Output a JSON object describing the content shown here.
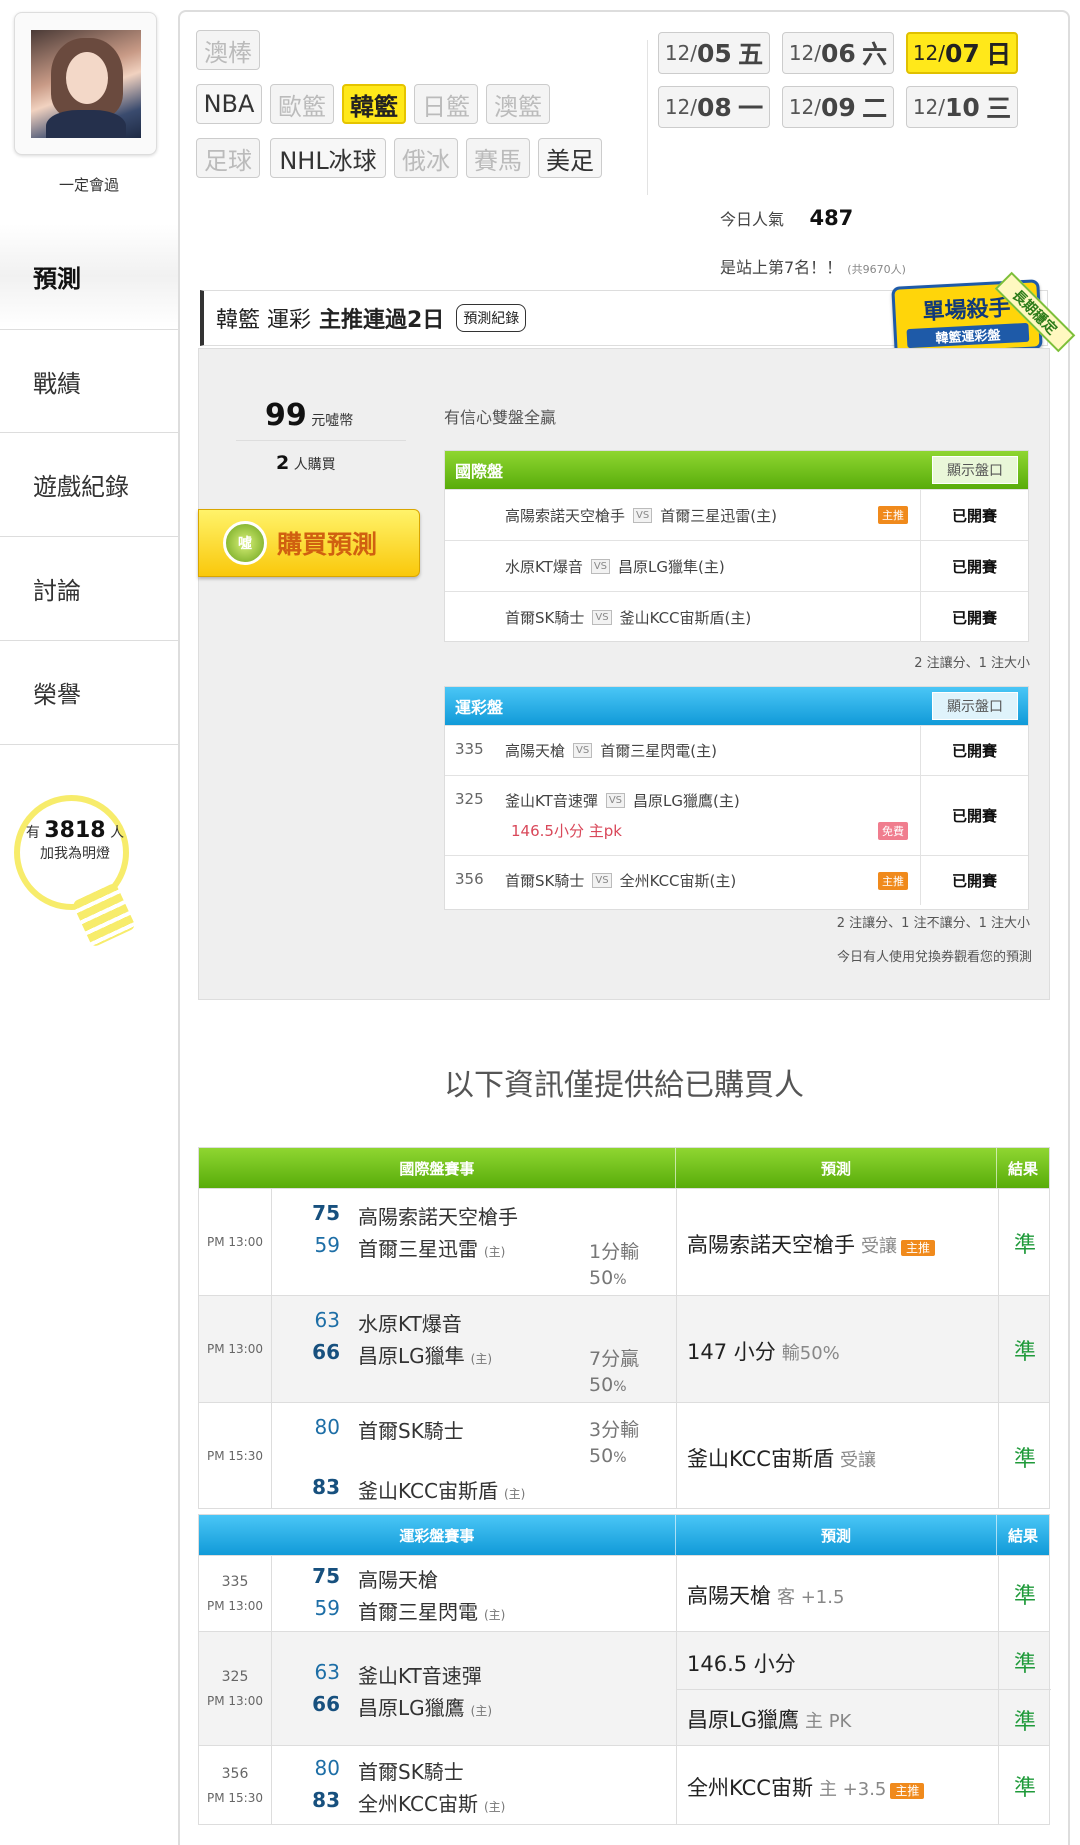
{
  "user": {
    "name": "一定會過"
  },
  "nav": [
    {
      "label": "預測",
      "active": true
    },
    {
      "label": "戰績"
    },
    {
      "label": "遊戲紀錄"
    },
    {
      "label": "討論"
    },
    {
      "label": "榮譽"
    }
  ],
  "lamp": {
    "prefix": "有",
    "count": "3818",
    "suffix": "人",
    "cta": "加我為明燈"
  },
  "sports": {
    "row1": [
      "澳棒"
    ],
    "row2": [
      "NBA",
      "歐籃",
      "韓籃",
      "日籃",
      "澳籃"
    ],
    "row3": [
      "足球",
      "NHL冰球",
      "俄冰",
      "賽馬",
      "美足"
    ],
    "selected": "韓籃"
  },
  "dates": [
    {
      "md": "12/",
      "d": "05",
      "w": "五"
    },
    {
      "md": "12/",
      "d": "06",
      "w": "六"
    },
    {
      "md": "12/",
      "d": "07",
      "w": "日",
      "selected": true
    },
    {
      "md": "12/",
      "d": "08",
      "w": "一"
    },
    {
      "md": "12/",
      "d": "09",
      "w": "二"
    },
    {
      "md": "12/",
      "d": "10",
      "w": "三"
    }
  ],
  "popularity": {
    "label": "今日人氣",
    "value": "487",
    "rank_text": "是站上第7名！！",
    "total": "(共9670人)"
  },
  "banner": {
    "title": "韓籃 運彩",
    "streak": "主推連過2日",
    "record_btn": "預測紀錄"
  },
  "badge": {
    "title": "單場殺手",
    "sub": "韓籃運彩盤",
    "ribbon": "長期穩定"
  },
  "offer": {
    "price": "99",
    "price_unit": "元噓幣",
    "buyers": "2",
    "buyers_unit": "人購買",
    "buy_label": "購買預測",
    "buy_icon": "噓",
    "confidence": "有信心雙盤全贏"
  },
  "intl": {
    "title": "國際盤",
    "show_btn": "顯示盤口",
    "rows": [
      {
        "home": "高陽索諾天空槍手",
        "vs": "VS",
        "away": "首爾三星迅雷(主)",
        "tag": "主推",
        "state": "已開賽"
      },
      {
        "home": "水原KT爆音",
        "vs": "VS",
        "away": "昌原LG獵隼(主)",
        "state": "已開賽"
      },
      {
        "home": "首爾SK騎士",
        "vs": "VS",
        "away": "釜山KCC宙斯盾(主)",
        "state": "已開賽"
      }
    ],
    "note": "2 注讓分、1 注大小"
  },
  "lottery": {
    "title": "運彩盤",
    "show_btn": "顯示盤口",
    "rows": [
      {
        "num": "335",
        "home": "高陽天槍",
        "vs": "VS",
        "away": "首爾三星閃電(主)",
        "state": "已開賽"
      },
      {
        "num": "325",
        "home": "釜山KT音速彈",
        "vs": "VS",
        "away": "昌原LG獵鷹(主)",
        "extra": "146.5小分 主pk",
        "tag": "免費",
        "state": "已開賽"
      },
      {
        "num": "356",
        "home": "首爾SK騎士",
        "vs": "VS",
        "away": "全州KCC宙斯(主)",
        "tag": "主推",
        "state": "已開賽"
      }
    ],
    "note": "2 注讓分、1 注不讓分、1 注大小",
    "note2": "今日有人使用兌換券觀看您的預測"
  },
  "buyers_heading": "以下資訊僅提供給已購買人",
  "intl_results": {
    "headers": [
      "國際盤賽事",
      "預測",
      "結果"
    ],
    "rows": [
      {
        "time": "PM 13:00",
        "s1": "75",
        "t1": "高陽索諾天空槍手",
        "s2": "59",
        "t2": "首爾三星迅雷",
        "t2tag": "(主)",
        "spread": "1分輸",
        "pct": "50",
        "pred": "高陽索諾天空槍手",
        "pred_note": "受讓",
        "pred_tag": "主推",
        "result": "準"
      },
      {
        "time": "PM 13:00",
        "s1": "63",
        "t1": "水原KT爆音",
        "s2": "66",
        "t2": "昌原LG獵隼",
        "t2tag": "(主)",
        "spread": "7分贏",
        "pct": "50",
        "pred": "147 小分",
        "pred_note": "輸50%",
        "result": "準"
      },
      {
        "time": "PM 15:30",
        "s1": "80",
        "t1": "首爾SK騎士",
        "s2": "83",
        "t2": "釜山KCC宙斯盾",
        "t2tag": "(主)",
        "spread": "3分輸",
        "pct": "50",
        "pred": "釜山KCC宙斯盾",
        "pred_note": "受讓",
        "result": "準"
      }
    ]
  },
  "lottery_results": {
    "headers": [
      "運彩盤賽事",
      "預測",
      "結果"
    ],
    "rows": [
      {
        "num": "335",
        "time": "PM 13:00",
        "s1": "75",
        "t1": "高陽天槍",
        "s2": "59",
        "t2": "首爾三星閃電",
        "t2tag": "(主)",
        "pred": "高陽天槍",
        "pred_note": "客 +1.5",
        "result": "準"
      },
      {
        "num": "325",
        "time": "PM 13:00",
        "s1": "63",
        "t1": "釜山KT音速彈",
        "s2": "66",
        "t2": "昌原LG獵鷹",
        "t2tag": "(主)",
        "pred": "146.5 小分",
        "result": "準",
        "pred2": "昌原LG獵鷹",
        "pred2_note": "主 PK",
        "result2": "準"
      },
      {
        "num": "356",
        "time": "PM 15:30",
        "s1": "80",
        "t1": "首爾SK騎士",
        "s2": "83",
        "t2": "全州KCC宙斯",
        "t2tag": "(主)",
        "pred": "全州KCC宙斯",
        "pred_note": "主 +3.5",
        "pred_tag": "主推",
        "result": "準"
      }
    ]
  },
  "colors": {
    "accent_yellow": "#ffe81a",
    "green_head": "#6cbf18",
    "blue_head": "#1aa7e2",
    "result_green": "#1f9a3a"
  }
}
